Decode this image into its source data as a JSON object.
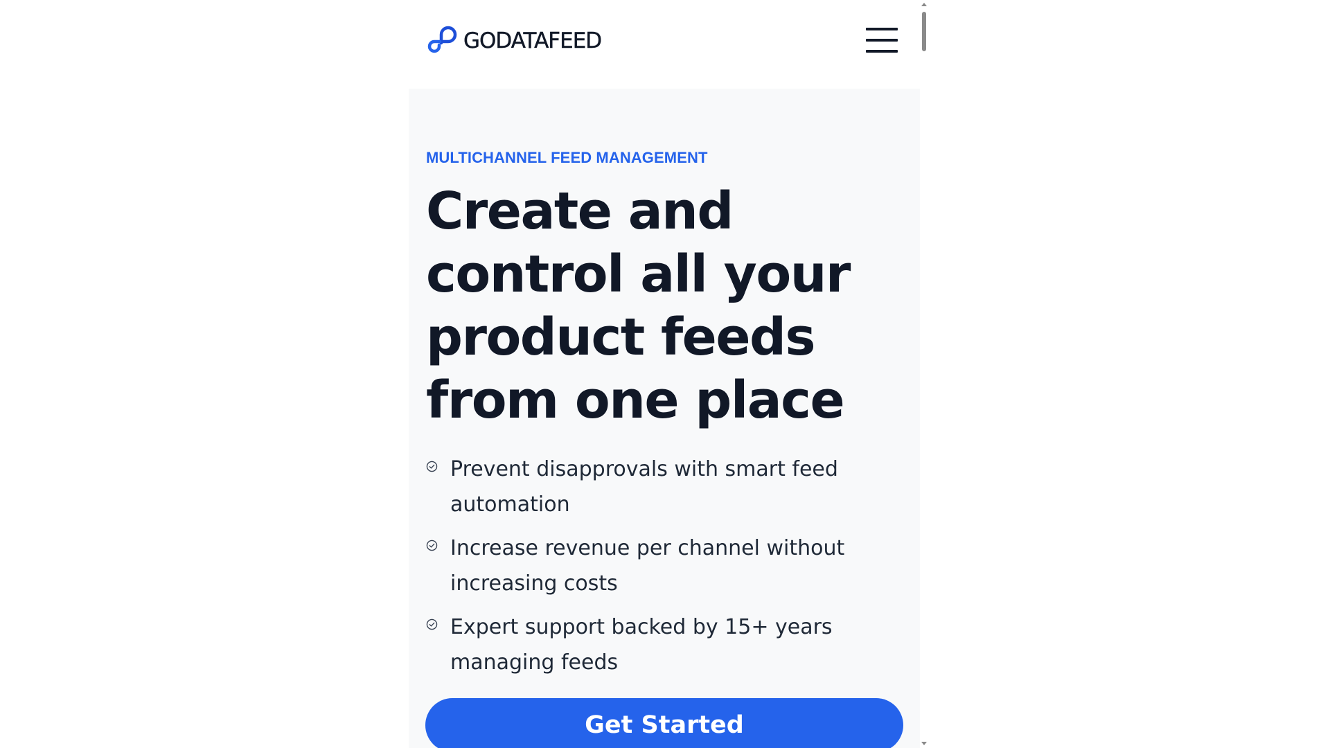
{
  "header": {
    "logo_text": "GODATAFEED",
    "logo_icon": "infinity-link-icon",
    "menu_icon": "hamburger-menu-icon"
  },
  "hero": {
    "eyebrow": "MULTICHANNEL FEED MANAGEMENT",
    "headline": "Create and control all your product feeds from one place",
    "benefits": [
      {
        "text": "Prevent disapprovals with smart feed automation",
        "icon": "check-circle-icon"
      },
      {
        "text": "Increase revenue per channel without increasing costs",
        "icon": "check-circle-icon"
      },
      {
        "text": "Expert support backed by 15+ years managing feeds",
        "icon": "check-circle-icon"
      }
    ],
    "cta_label": "Get Started"
  },
  "colors": {
    "accent": "#2563eb",
    "heading": "#111827",
    "hero_background": "#f8f9fa"
  }
}
